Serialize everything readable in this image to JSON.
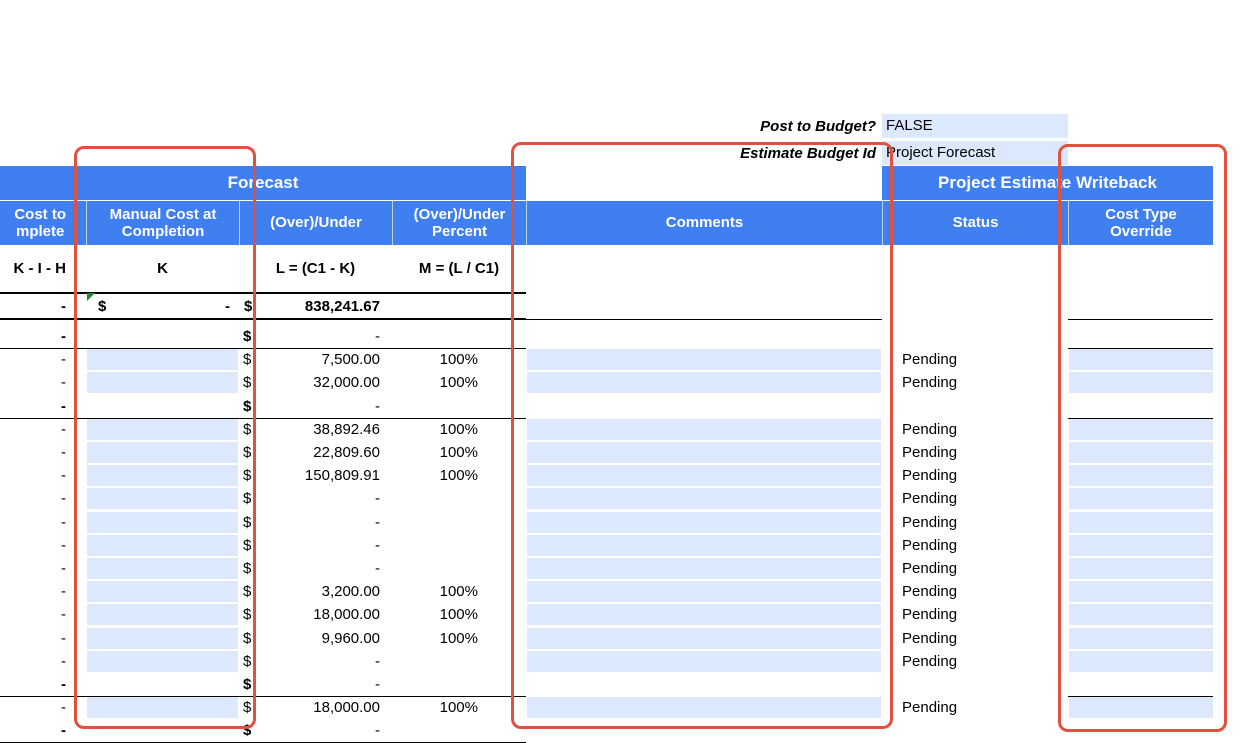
{
  "top": {
    "post_label": "Post to Budget?",
    "post_value": "FALSE",
    "estimate_label": "Estimate Budget Id",
    "estimate_value": "Project Forecast"
  },
  "groups": {
    "forecast": "Forecast",
    "writeback": "Project Estimate Writeback"
  },
  "columns": {
    "cost_to_complete": "Cost to\nmplete",
    "manual_cost": "Manual Cost at Completion",
    "over_under": "(Over)/Under",
    "over_under_pct": "(Over)/Under Percent",
    "comments": "Comments",
    "status": "Status",
    "cost_type_override": "Cost Type Override"
  },
  "formulas": {
    "cost_to_complete": "K - I - H",
    "manual_cost": "K",
    "over_under": "L = (C1 - K)",
    "pct": "M = (L / C1)"
  },
  "totals": {
    "manual_cost_dollar": "$",
    "manual_cost_dash": "-",
    "over_under_value": "838,241.67",
    "over_under_dollar": "$"
  },
  "rows": [
    {
      "ctc": "-",
      "val": "-",
      "pct": "",
      "status": ""
    },
    {
      "ctc": "-",
      "val": "7,500.00",
      "pct": "100%",
      "status": "Pending"
    },
    {
      "ctc": "-",
      "val": "32,000.00",
      "pct": "100%",
      "status": "Pending"
    },
    {
      "ctc": "-",
      "val": "-",
      "pct": "",
      "status": ""
    },
    {
      "ctc": "-",
      "val": "38,892.46",
      "pct": "100%",
      "status": "Pending"
    },
    {
      "ctc": "-",
      "val": "22,809.60",
      "pct": "100%",
      "status": "Pending"
    },
    {
      "ctc": "-",
      "val": "150,809.91",
      "pct": "100%",
      "status": "Pending"
    },
    {
      "ctc": "-",
      "val": "-",
      "pct": "",
      "status": "Pending"
    },
    {
      "ctc": "-",
      "val": "-",
      "pct": "",
      "status": "Pending"
    },
    {
      "ctc": "-",
      "val": "-",
      "pct": "",
      "status": "Pending"
    },
    {
      "ctc": "-",
      "val": "-",
      "pct": "",
      "status": "Pending"
    },
    {
      "ctc": "-",
      "val": "3,200.00",
      "pct": "100%",
      "status": "Pending"
    },
    {
      "ctc": "-",
      "val": "18,000.00",
      "pct": "100%",
      "status": "Pending"
    },
    {
      "ctc": "-",
      "val": "9,960.00",
      "pct": "100%",
      "status": "Pending"
    },
    {
      "ctc": "-",
      "val": "-",
      "pct": "",
      "status": "Pending"
    },
    {
      "ctc": "-",
      "val": "-",
      "pct": "",
      "status": ""
    },
    {
      "ctc": "-",
      "val": "18,000.00",
      "pct": "100%",
      "status": "Pending"
    },
    {
      "ctc": "-",
      "val": "-",
      "pct": "",
      "status": ""
    }
  ],
  "dollar_sign": "$",
  "colors": {
    "header_blue": "#3f7ff0",
    "input_blue": "#dce8fb",
    "annotation_red": "#e0523f"
  }
}
